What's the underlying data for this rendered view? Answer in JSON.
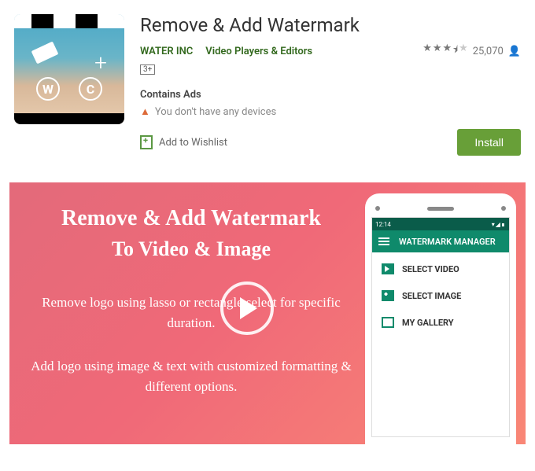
{
  "app": {
    "title": "Remove & Add Watermark",
    "developer": "WATER INC",
    "category": "Video Players & Editors",
    "age_rating": "3+",
    "rating_stars": 3.5,
    "rating_count": "25,070",
    "contains_ads": "Contains Ads",
    "device_warning": "You don't have any devices",
    "wishlist_label": "Add to Wishlist",
    "install_label": "Install",
    "icon_letters": {
      "w": "W",
      "c": "C",
      "plus": "+"
    }
  },
  "promo": {
    "title_line1": "Remove & Add Watermark",
    "title_line2": "To Video & Image",
    "desc1": "Remove logo using lasso or rectangle select for specific duration.",
    "desc2": "Add logo using image & text with customized formatting & different options."
  },
  "phone": {
    "status_time": "12:14",
    "appbar_title": "WATERMARK MANAGER",
    "menu": [
      {
        "label": "SELECT VIDEO"
      },
      {
        "label": "SELECT IMAGE"
      },
      {
        "label": "MY GALLERY"
      }
    ]
  }
}
